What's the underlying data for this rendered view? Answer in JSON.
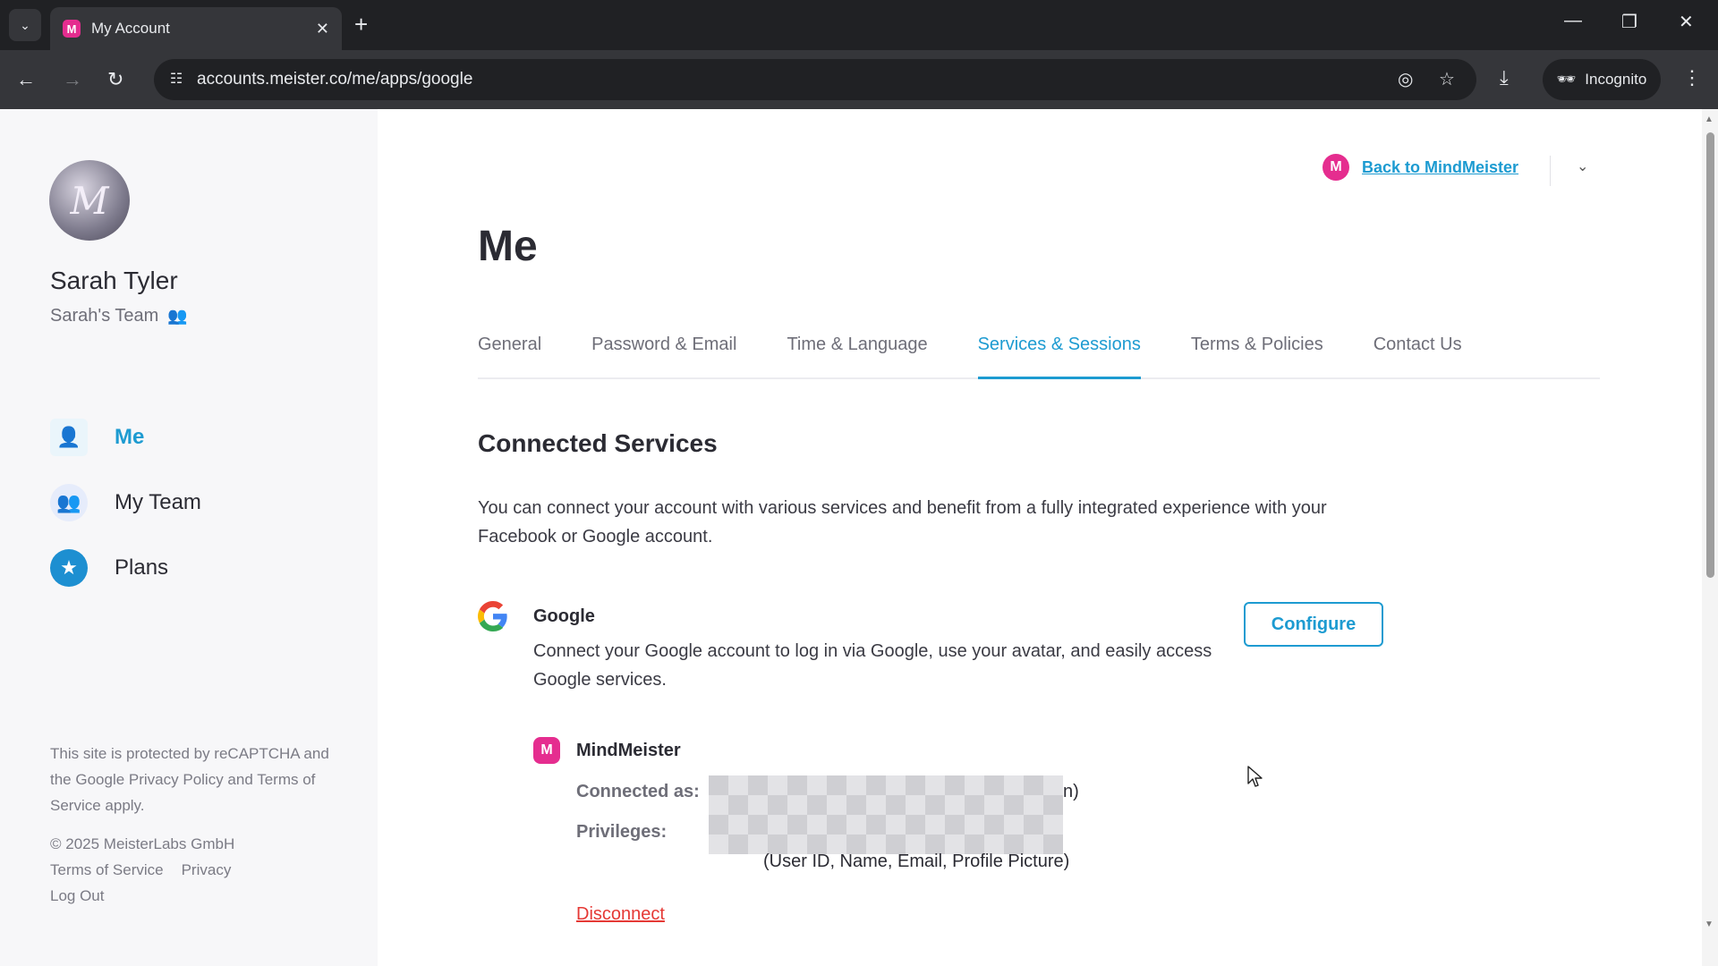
{
  "browser": {
    "tab_title": "My Account",
    "tab_favicon": "M",
    "url": "accounts.meister.co/me/apps/google",
    "incognito_label": "Incognito"
  },
  "sidebar": {
    "avatar_letter": "M",
    "user_name": "Sarah Tyler",
    "team_name": "Sarah's Team",
    "items": [
      {
        "label": "Me",
        "icon": "profile-card-icon",
        "active": true
      },
      {
        "label": "My Team",
        "icon": "team-icon",
        "active": false
      },
      {
        "label": "Plans",
        "icon": "badge-star-icon",
        "active": false
      }
    ],
    "footer": {
      "recaptcha_text": "This site is protected by reCAPTCHA and the Google Privacy Policy and Terms of Service apply.",
      "copyright": "© 2025 MeisterLabs GmbH",
      "terms_link": "Terms of Service",
      "privacy_link": "Privacy",
      "logout_link": "Log Out"
    }
  },
  "header": {
    "back_logo": "M",
    "back_label": "Back to MindMeister"
  },
  "main": {
    "title": "Me",
    "tabs": [
      {
        "label": "General",
        "active": false
      },
      {
        "label": "Password & Email",
        "active": false
      },
      {
        "label": "Time & Language",
        "active": false
      },
      {
        "label": "Services & Sessions",
        "active": true
      },
      {
        "label": "Terms & Policies",
        "active": false
      },
      {
        "label": "Contact Us",
        "active": false
      }
    ],
    "section_title": "Connected Services",
    "section_desc": "You can connect your account with various services and benefit from a fully integrated experience with your Facebook or Google account.",
    "service": {
      "name": "Google",
      "description": "Connect your Google account to log in via Google, use your avatar, and easily access Google services.",
      "configure_label": "Configure",
      "app": {
        "logo": "M",
        "name": "MindMeister",
        "connected_label": "Connected as:",
        "connected_tail": "n)",
        "privileges_label": "Privileges:",
        "privileges_value": "(User ID, Name, Email, Profile Picture)",
        "disconnect_label": "Disconnect"
      }
    }
  },
  "colors": {
    "accent": "#1d9bd1",
    "brand": "#e52d8f",
    "danger": "#e53935"
  }
}
